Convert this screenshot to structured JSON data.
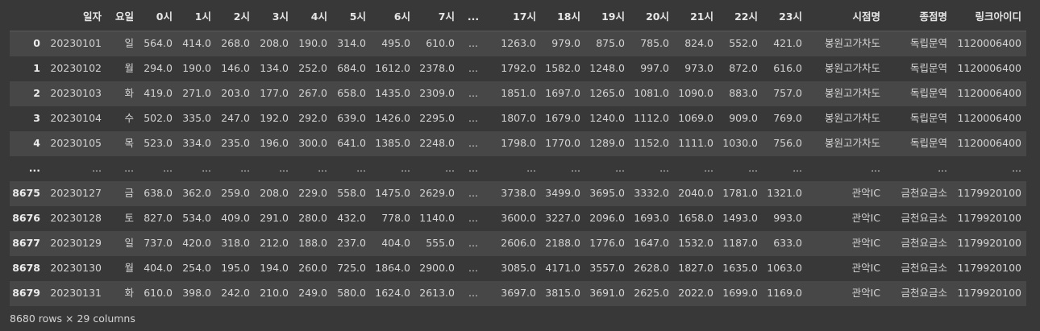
{
  "columns": [
    "",
    "일자",
    "요일",
    "0시",
    "1시",
    "2시",
    "3시",
    "4시",
    "5시",
    "6시",
    "7시",
    "...",
    "17시",
    "18시",
    "19시",
    "20시",
    "21시",
    "22시",
    "23시",
    "시점명",
    "종점명",
    "링크아이디"
  ],
  "rows": [
    [
      "0",
      "20230101",
      "일",
      "564.0",
      "414.0",
      "268.0",
      "208.0",
      "190.0",
      "314.0",
      "495.0",
      "610.0",
      "...",
      "1263.0",
      "979.0",
      "875.0",
      "785.0",
      "824.0",
      "552.0",
      "421.0",
      "봉원고가차도",
      "독립문역",
      "1120006400"
    ],
    [
      "1",
      "20230102",
      "월",
      "294.0",
      "190.0",
      "146.0",
      "134.0",
      "252.0",
      "684.0",
      "1612.0",
      "2378.0",
      "...",
      "1792.0",
      "1582.0",
      "1248.0",
      "997.0",
      "973.0",
      "872.0",
      "616.0",
      "봉원고가차도",
      "독립문역",
      "1120006400"
    ],
    [
      "2",
      "20230103",
      "화",
      "419.0",
      "271.0",
      "203.0",
      "177.0",
      "267.0",
      "658.0",
      "1435.0",
      "2309.0",
      "...",
      "1851.0",
      "1697.0",
      "1265.0",
      "1081.0",
      "1090.0",
      "883.0",
      "757.0",
      "봉원고가차도",
      "독립문역",
      "1120006400"
    ],
    [
      "3",
      "20230104",
      "수",
      "502.0",
      "335.0",
      "247.0",
      "192.0",
      "292.0",
      "639.0",
      "1426.0",
      "2295.0",
      "...",
      "1807.0",
      "1679.0",
      "1240.0",
      "1112.0",
      "1069.0",
      "909.0",
      "769.0",
      "봉원고가차도",
      "독립문역",
      "1120006400"
    ],
    [
      "4",
      "20230105",
      "목",
      "523.0",
      "334.0",
      "235.0",
      "196.0",
      "300.0",
      "641.0",
      "1385.0",
      "2248.0",
      "...",
      "1798.0",
      "1770.0",
      "1289.0",
      "1152.0",
      "1111.0",
      "1030.0",
      "756.0",
      "봉원고가차도",
      "독립문역",
      "1120006400"
    ],
    [
      "...",
      "...",
      "...",
      "...",
      "...",
      "...",
      "...",
      "...",
      "...",
      "...",
      "...",
      "...",
      "...",
      "...",
      "...",
      "...",
      "...",
      "...",
      "...",
      "...",
      "...",
      "..."
    ],
    [
      "8675",
      "20230127",
      "금",
      "638.0",
      "362.0",
      "259.0",
      "208.0",
      "229.0",
      "558.0",
      "1475.0",
      "2629.0",
      "...",
      "3738.0",
      "3499.0",
      "3695.0",
      "3332.0",
      "2040.0",
      "1781.0",
      "1321.0",
      "관악IC",
      "금천요금소",
      "1179920100"
    ],
    [
      "8676",
      "20230128",
      "토",
      "827.0",
      "534.0",
      "409.0",
      "291.0",
      "280.0",
      "432.0",
      "778.0",
      "1140.0",
      "...",
      "3600.0",
      "3227.0",
      "2096.0",
      "1693.0",
      "1658.0",
      "1493.0",
      "993.0",
      "관악IC",
      "금천요금소",
      "1179920100"
    ],
    [
      "8677",
      "20230129",
      "일",
      "737.0",
      "420.0",
      "318.0",
      "212.0",
      "188.0",
      "237.0",
      "404.0",
      "555.0",
      "...",
      "2606.0",
      "2188.0",
      "1776.0",
      "1647.0",
      "1532.0",
      "1187.0",
      "633.0",
      "관악IC",
      "금천요금소",
      "1179920100"
    ],
    [
      "8678",
      "20230130",
      "월",
      "404.0",
      "254.0",
      "195.0",
      "194.0",
      "260.0",
      "725.0",
      "1864.0",
      "2900.0",
      "...",
      "3085.0",
      "4171.0",
      "3557.0",
      "2628.0",
      "1827.0",
      "1635.0",
      "1063.0",
      "관악IC",
      "금천요금소",
      "1179920100"
    ],
    [
      "8679",
      "20230131",
      "화",
      "610.0",
      "398.0",
      "242.0",
      "210.0",
      "249.0",
      "580.0",
      "1624.0",
      "2613.0",
      "...",
      "3697.0",
      "3815.0",
      "3691.0",
      "2625.0",
      "2022.0",
      "1699.0",
      "1169.0",
      "관악IC",
      "금천요금소",
      "1179920100"
    ]
  ],
  "footer": "8680 rows × 29 columns",
  "colors": {
    "background": "#383838",
    "row_odd": "#474747",
    "text": "#d4d4d4"
  }
}
